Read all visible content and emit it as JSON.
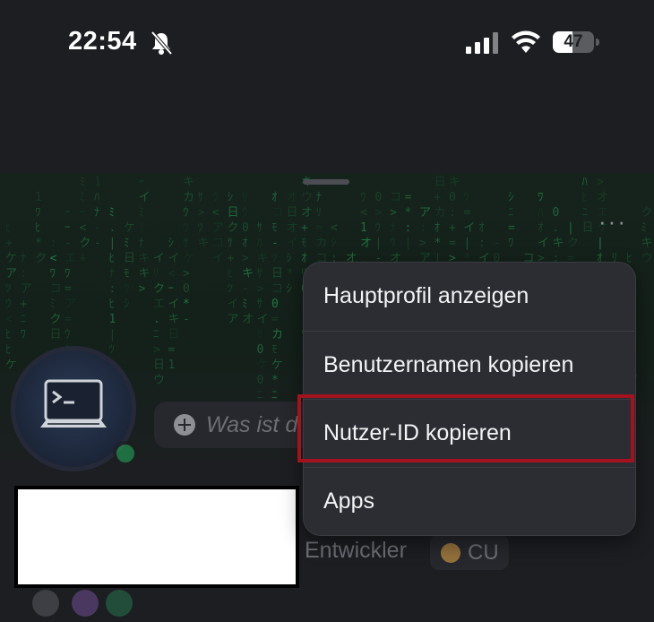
{
  "status_bar": {
    "time": "22:54",
    "battery_percent": "47",
    "battery_level": 0.47,
    "icons": [
      "bell-slash-icon",
      "cellular-signal-icon",
      "wifi-icon",
      "battery-icon"
    ]
  },
  "profile": {
    "more_icon": "ellipsis-icon",
    "status_placeholder": "Was ist d",
    "status_icon": "plus-circle-icon",
    "avatar_icon": "laptop-terminal-icon",
    "online_color": "#23a559",
    "tags": {
      "developer": "Entwickler",
      "cu_label": "CU"
    }
  },
  "context_menu": {
    "items": [
      {
        "label": "Hauptprofil anzeigen"
      },
      {
        "label": "Benutzernamen kopieren"
      },
      {
        "label": "Nutzer-ID kopieren"
      },
      {
        "label": "Apps"
      }
    ],
    "highlighted_index": 2,
    "highlight_color": "#a3121e"
  }
}
